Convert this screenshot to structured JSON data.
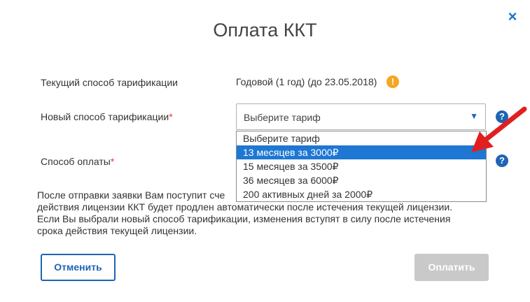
{
  "dialog": {
    "title": "Оплата ККТ",
    "close_icon": "×"
  },
  "form": {
    "current_label": "Текущий способ тарификации",
    "current_value": "Годовой (1 год) (до 23.05.2018)",
    "warning_icon": "!",
    "new_label": "Новый способ тарификации",
    "required_mark": "*",
    "payment_label": "Способ оплаты",
    "help_icon": "?",
    "tariff_select": {
      "value": "Выберите тариф",
      "caret": "▼",
      "options": [
        "Выберите тариф",
        "13 месяцев за 3000₽",
        "15 месяцев за 3500₽",
        "36 месяцев за 6000₽",
        "200 активных дней за 2000₽"
      ],
      "highlighted_index": 1
    }
  },
  "notice": {
    "lines": [
      "После отправки заявки Вам поступит сче",
      "действия лицензии ККТ будет продлен автоматически после истечения текущей лицензии.",
      "Если Вы выбрали новый способ тарификации, изменения вступят в силу после истечения",
      "срока действия текущей лицензии."
    ]
  },
  "buttons": {
    "cancel": "Отменить",
    "pay": "Оплатить"
  },
  "colors": {
    "accent": "#1f64b4",
    "highlight": "#1e77d2",
    "warning": "#f5a623",
    "arrow": "#e02020"
  }
}
